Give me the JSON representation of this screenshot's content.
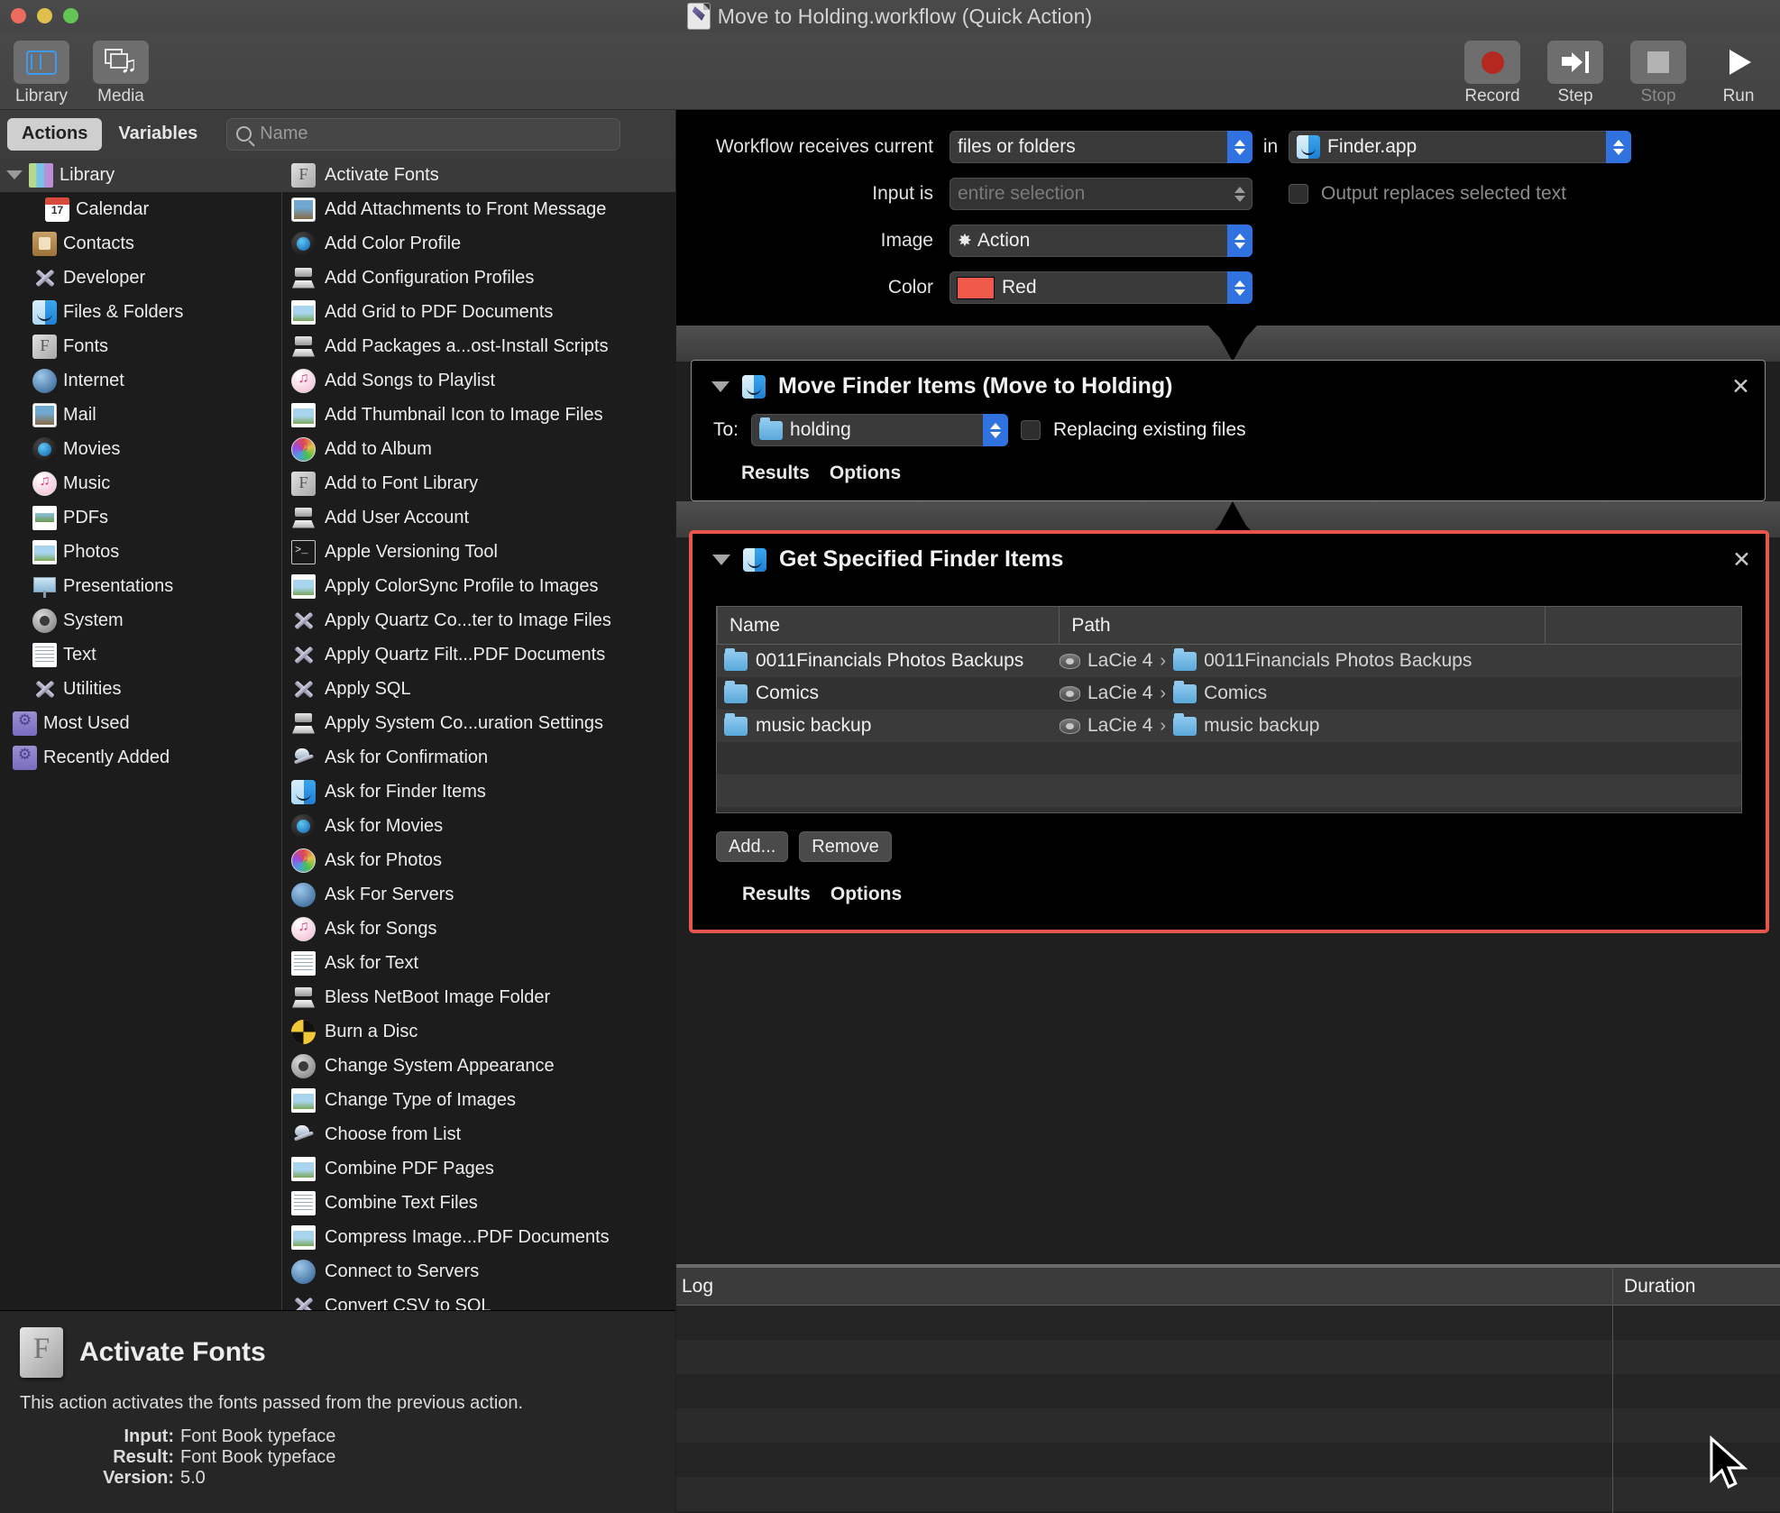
{
  "window": {
    "title": "Move to Holding.workflow (Quick Action)",
    "traffic_lights": [
      "close-button",
      "minimize-button",
      "zoom-button"
    ]
  },
  "toolbar": {
    "left_items": [
      {
        "label": "Library",
        "icon": "library-icon",
        "active": true
      },
      {
        "label": "Media",
        "icon": "media-icon",
        "active": false
      }
    ],
    "right_items": [
      {
        "label": "Record",
        "icon": "record-icon",
        "enabled": true
      },
      {
        "label": "Step",
        "icon": "step-icon",
        "enabled": true
      },
      {
        "label": "Stop",
        "icon": "stop-icon",
        "enabled": false
      },
      {
        "label": "Run",
        "icon": "run-icon",
        "enabled": true
      }
    ]
  },
  "segmented": {
    "tabs": [
      {
        "label": "Actions",
        "active": true
      },
      {
        "label": "Variables",
        "active": false
      }
    ]
  },
  "search": {
    "placeholder": "Name",
    "value": "",
    "icon": "search-icon"
  },
  "library": {
    "header": {
      "label": "Library",
      "icon": "books-icon",
      "expanded": true
    },
    "items": [
      {
        "label": "Calendar",
        "icon": "calendar-icon"
      },
      {
        "label": "Contacts",
        "icon": "contacts-icon"
      },
      {
        "label": "Developer",
        "icon": "developer-icon"
      },
      {
        "label": "Files & Folders",
        "icon": "finder-icon"
      },
      {
        "label": "Fonts",
        "icon": "fontbook-icon"
      },
      {
        "label": "Internet",
        "icon": "globe-icon"
      },
      {
        "label": "Mail",
        "icon": "mail-icon"
      },
      {
        "label": "Movies",
        "icon": "quicktime-icon"
      },
      {
        "label": "Music",
        "icon": "music-icon"
      },
      {
        "label": "PDFs",
        "icon": "pdf-icon"
      },
      {
        "label": "Photos",
        "icon": "photos-icon"
      },
      {
        "label": "Presentations",
        "icon": "presentation-icon"
      },
      {
        "label": "System",
        "icon": "system-prefs-icon"
      },
      {
        "label": "Text",
        "icon": "textedit-icon"
      },
      {
        "label": "Utilities",
        "icon": "developer-icon"
      }
    ],
    "groups": [
      {
        "label": "Most Used",
        "icon": "purple-folder-icon"
      },
      {
        "label": "Recently Added",
        "icon": "purple-folder-icon"
      }
    ]
  },
  "actions": [
    {
      "label": "Activate Fonts",
      "icon": "fontbook-icon",
      "selected": true
    },
    {
      "label": "Add Attachments to Front Message",
      "icon": "mail-icon"
    },
    {
      "label": "Add Color Profile",
      "icon": "quicktime-icon"
    },
    {
      "label": "Add Configuration Profiles",
      "icon": "package-icon"
    },
    {
      "label": "Add Grid to PDF Documents",
      "icon": "photos-icon"
    },
    {
      "label": "Add Packages a...ost-Install Scripts",
      "icon": "package-icon"
    },
    {
      "label": "Add Songs to Playlist",
      "icon": "music-icon"
    },
    {
      "label": "Add Thumbnail Icon to Image Files",
      "icon": "photos-icon"
    },
    {
      "label": "Add to Album",
      "icon": "photos-app-icon"
    },
    {
      "label": "Add to Font Library",
      "icon": "fontbook-icon"
    },
    {
      "label": "Add User Account",
      "icon": "package-icon"
    },
    {
      "label": "Apple Versioning Tool",
      "icon": "terminal-icon"
    },
    {
      "label": "Apply ColorSync Profile to Images",
      "icon": "photos-icon"
    },
    {
      "label": "Apply Quartz Co...ter to Image Files",
      "icon": "developer-icon"
    },
    {
      "label": "Apply Quartz Filt...PDF Documents",
      "icon": "developer-icon"
    },
    {
      "label": "Apply SQL",
      "icon": "developer-icon"
    },
    {
      "label": "Apply System Co...uration Settings",
      "icon": "package-icon"
    },
    {
      "label": "Ask for Confirmation",
      "icon": "automator-robot-icon"
    },
    {
      "label": "Ask for Finder Items",
      "icon": "finder-icon"
    },
    {
      "label": "Ask for Movies",
      "icon": "quicktime-icon"
    },
    {
      "label": "Ask for Photos",
      "icon": "photos-app-icon"
    },
    {
      "label": "Ask For Servers",
      "icon": "globe-icon"
    },
    {
      "label": "Ask for Songs",
      "icon": "music-icon"
    },
    {
      "label": "Ask for Text",
      "icon": "textedit-icon"
    },
    {
      "label": "Bless NetBoot Image Folder",
      "icon": "package-icon"
    },
    {
      "label": "Burn a Disc",
      "icon": "burn-icon"
    },
    {
      "label": "Change System Appearance",
      "icon": "system-prefs-icon"
    },
    {
      "label": "Change Type of Images",
      "icon": "photos-icon"
    },
    {
      "label": "Choose from List",
      "icon": "automator-robot-icon"
    },
    {
      "label": "Combine PDF Pages",
      "icon": "photos-icon"
    },
    {
      "label": "Combine Text Files",
      "icon": "textedit-icon"
    },
    {
      "label": "Compress Image...PDF Documents",
      "icon": "photos-icon"
    },
    {
      "label": "Connect to Servers",
      "icon": "globe-icon"
    },
    {
      "label": "Convert CSV to SQL",
      "icon": "developer-icon"
    }
  ],
  "description": {
    "icon": "fontbook-icon",
    "title": "Activate Fonts",
    "body": "This action activates the fonts passed from the previous action.",
    "fields": [
      {
        "key": "Input:",
        "value": "Font Book typeface"
      },
      {
        "key": "Result:",
        "value": "Font Book typeface"
      },
      {
        "key": "Version:",
        "value": "5.0"
      }
    ]
  },
  "workflow_settings": {
    "receives_label": "Workflow receives current",
    "receives_value": "files or folders",
    "in_label": "in",
    "in_value": "Finder.app",
    "in_icon": "finder-icon",
    "input_is_label": "Input is",
    "input_is_value": "entire selection",
    "output_replaces_label": "Output replaces selected text",
    "output_replaces_checked": false,
    "image_label": "Image",
    "image_value": "Action",
    "image_glyph": "gear-icon",
    "color_label": "Color",
    "color_value": "Red",
    "color_hex": "#f05a4a"
  },
  "action_blocks": [
    {
      "title": "Move Finder Items (Move to Holding)",
      "icon": "finder-icon",
      "expanded": true,
      "highlighted": false,
      "to_label": "To:",
      "to_value": "holding",
      "to_icon": "folder-icon",
      "replacing_label": "Replacing existing files",
      "replacing_checked": false,
      "tabs": [
        "Results",
        "Options"
      ],
      "close_icon": "close-icon"
    },
    {
      "title": "Get Specified Finder Items",
      "icon": "finder-icon",
      "expanded": true,
      "highlighted": true,
      "close_icon": "close-icon",
      "table": {
        "columns": [
          "Name",
          "Path"
        ],
        "rows": [
          {
            "name": "0011Financials Photos Backups",
            "path_disk": "LaCie 4",
            "path_folder": "0011Financials Photos Backups"
          },
          {
            "name": "Comics",
            "path_disk": "LaCie 4",
            "path_folder": "Comics"
          },
          {
            "name": "music backup",
            "path_disk": "LaCie 4",
            "path_folder": "music backup"
          }
        ]
      },
      "buttons": [
        "Add...",
        "Remove"
      ],
      "tabs": [
        "Results",
        "Options"
      ]
    }
  ],
  "log": {
    "columns": [
      "Log",
      "Duration"
    ],
    "rows": []
  },
  "colors": {
    "highlight_border": "#e8554a",
    "accent_blue": "#2f72e0",
    "window_chrome": "#454545",
    "panel_background": "#1c1c1c"
  },
  "cursor": {
    "icon": "arrow-cursor"
  }
}
